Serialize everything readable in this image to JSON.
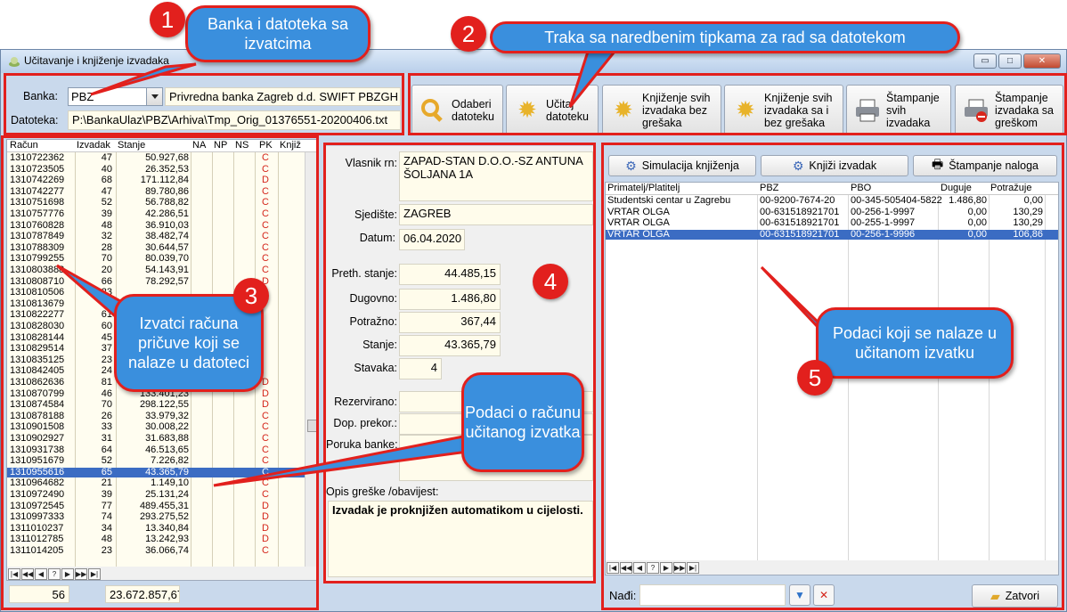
{
  "window": {
    "title": "Učitavanje i knjiženje izvadaka",
    "controls": [
      "▭",
      "□",
      "✕"
    ]
  },
  "bank": {
    "label": "Banka:",
    "code": "PBZ",
    "name": "Privredna banka Zagreb d.d. SWIFT PBZGH",
    "file_label": "Datoteka:",
    "file_path": "P:\\BankaUlaz\\PBZ\\Arhiva\\Tmp_Orig_01376551-20200406.txt"
  },
  "toolbar": {
    "open": "Odaberi datoteku",
    "load": "Učitaj datoteku",
    "post_all": "Knjiženje svih izvadaka bez grešaka",
    "post_all_err": "Knjiženje svih izvadaka sa i bez grešaka",
    "print_all": "Štampanje svih izvadaka",
    "print_err": "Štampanje izvadaka sa greškom"
  },
  "accounts_list": {
    "columns": [
      "Račun",
      "Izvadak",
      "Stanje",
      "NA",
      "NP",
      "NS",
      "PK",
      "Knjiž"
    ],
    "rows": [
      [
        "1310722362",
        "47",
        "50.927,68",
        "C"
      ],
      [
        "1310723505",
        "40",
        "26.352,53",
        "C"
      ],
      [
        "1310742269",
        "68",
        "171.112,84",
        "D"
      ],
      [
        "1310742277",
        "47",
        "89.780,86",
        "C"
      ],
      [
        "1310751698",
        "52",
        "56.788,82",
        "C"
      ],
      [
        "1310757776",
        "39",
        "42.286,51",
        "C"
      ],
      [
        "1310760828",
        "48",
        "36.910,03",
        "C"
      ],
      [
        "1310787849",
        "32",
        "38.482,74",
        "C"
      ],
      [
        "1310788309",
        "28",
        "30.644,57",
        "C"
      ],
      [
        "1310799255",
        "70",
        "80.039,70",
        "C"
      ],
      [
        "1310803888",
        "20",
        "54.143,91",
        "C"
      ],
      [
        "1310808710",
        "66",
        "78.292,57",
        "D"
      ],
      [
        "1310810506",
        "23",
        "",
        ""
      ],
      [
        "1310813679",
        "38",
        "",
        ""
      ],
      [
        "1310822277",
        "61",
        "",
        ""
      ],
      [
        "1310828030",
        "60",
        "",
        ""
      ],
      [
        "1310828144",
        "45",
        "",
        ""
      ],
      [
        "1310829514",
        "37",
        "",
        ""
      ],
      [
        "1310835125",
        "23",
        "",
        ""
      ],
      [
        "1310842405",
        "24",
        "",
        ""
      ],
      [
        "1310862636",
        "81",
        "",
        "D"
      ],
      [
        "1310870799",
        "46",
        "133.401,23",
        "D"
      ],
      [
        "1310874584",
        "70",
        "298.122,55",
        "D"
      ],
      [
        "1310878188",
        "26",
        "33.979,32",
        "C"
      ],
      [
        "1310901508",
        "33",
        "30.008,22",
        "C"
      ],
      [
        "1310902927",
        "31",
        "31.683,88",
        "C"
      ],
      [
        "1310931738",
        "64",
        "46.513,65",
        "C"
      ],
      [
        "1310951679",
        "52",
        "7.226,82",
        "C"
      ],
      [
        "1310955616",
        "65",
        "43.365,79",
        "C"
      ],
      [
        "1310964682",
        "21",
        "1.149,10",
        "C"
      ],
      [
        "1310972490",
        "39",
        "25.131,24",
        "C"
      ],
      [
        "1310972545",
        "77",
        "489.455,31",
        "D"
      ],
      [
        "1310997333",
        "74",
        "293.275,52",
        "D"
      ],
      [
        "1311010237",
        "34",
        "13.340,84",
        "D"
      ],
      [
        "1311012785",
        "48",
        "13.242,93",
        "D"
      ],
      [
        "1311014205",
        "23",
        "36.066,74",
        "C"
      ]
    ],
    "selected_row": 28,
    "footer_count": "56",
    "footer_total": "23.672.857,67"
  },
  "detail": {
    "owner_label": "Vlasnik rn:",
    "owner_value": "ZAPAD-STAN D.O.O.-SZ ANTUNA ŠOLJANA 1A",
    "seat_label": "Sjedište:",
    "seat_value": "ZAGREB",
    "date_label": "Datum:",
    "date_value": "06.04.2020",
    "prev_label": "Preth. stanje:",
    "prev_value": "44.485,15",
    "debit_label": "Dugovno:",
    "debit_value": "1.486,80",
    "credit_label": "Potražno:",
    "credit_value": "367,44",
    "balance_label": "Stanje:",
    "balance_value": "43.365,79",
    "items_label": "Stavaka:",
    "items_value": "4",
    "reserved_label": "Rezervirano:",
    "overdraft_label": "Dop. prekor.:",
    "message_label": "Poruka banke:",
    "error_label": "Opis greške /obavijest:",
    "error_value": "Izvadak je proknjižen automatikom u cijelosti."
  },
  "statement": {
    "simulate": "Simulacija knjiženja",
    "post": "Knjiži izvadak",
    "print": "Štampanje naloga",
    "columns": [
      "Primatelj/Platitelj",
      "PBZ",
      "PBO",
      "Duguje",
      "Potražuje"
    ],
    "rows": [
      [
        "Studentski centar u Zagrebu",
        "00-9200-7674-20",
        "00-345-505404-5822",
        "1.486,80",
        "0,00"
      ],
      [
        "VRTAR OLGA",
        "00-631518921701",
        "00-256-1-9997",
        "0,00",
        "130,29"
      ],
      [
        "VRTAR OLGA",
        "00-631518921701",
        "00-255-1-9997",
        "0,00",
        "130,29"
      ],
      [
        "VRTAR OLGA",
        "00-631518921701",
        "00-256-1-9996",
        "0,00",
        "106,86"
      ]
    ],
    "selected_row": 3,
    "find_label": "Nađi:",
    "close": "Zatvori"
  },
  "annotations": {
    "c1": "1",
    "c2": "2",
    "c3": "3",
    "c4": "4",
    "c5": "5",
    "b1": "Banka i datoteka sa izvatcima",
    "b2": "Traka sa naredbenim tipkama za rad sa datotekom",
    "b3": "Izvatci računa pričuve koji se nalaze u datoteci",
    "b4": "Podaci o računu učitanog izvatka",
    "b5": "Podaci koji se nalaze u učitanom izvatku"
  },
  "nav_glyphs": [
    "|◀",
    "◀◀",
    "◀",
    "?",
    "▶",
    "▶▶",
    "▶|"
  ]
}
